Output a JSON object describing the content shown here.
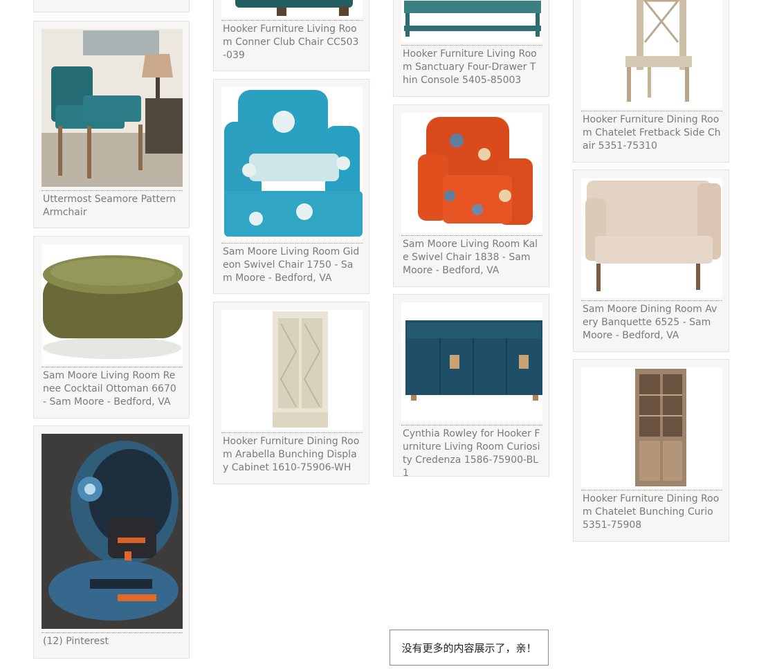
{
  "pins": [
    {
      "id": "uttermost-seamore",
      "caption": "Uttermost Seamore Pattern Armchair",
      "image_subject": "teal-armchair-image"
    },
    {
      "id": "sam-moore-renee-ottoman",
      "caption": "Sam Moore Living Room Renee Cocktail Ottoman 6670 - Sam Moore - Bedford, VA",
      "image_subject": "olive-round-ottoman-image"
    },
    {
      "id": "pinterest-robot",
      "caption": "(12) Pinterest",
      "image_subject": "robot-bust-image"
    },
    {
      "id": "hooker-conner-club-chair",
      "caption": "Hooker Furniture Living Room Conner Club Chair CC503-039",
      "image_subject": "club-chair-image"
    },
    {
      "id": "sam-moore-gideon-swivel",
      "caption": "Sam Moore Living Room Gideon Swivel Chair 1750 - Sam Moore - Bedford, VA",
      "image_subject": "blue-ikat-swivel-chair-image"
    },
    {
      "id": "hooker-arabella-cabinet",
      "caption": "Hooker Furniture Dining Room Arabella Bunching Display Cabinet 1610-75906-WH",
      "image_subject": "white-display-cabinet-image"
    },
    {
      "id": "hooker-sanctuary-console",
      "caption": "Hooker Furniture Living Room Sanctuary Four-Drawer Thin Console 5405-85003",
      "image_subject": "teal-console-image"
    },
    {
      "id": "sam-moore-kale-swivel",
      "caption": "Sam Moore Living Room Kale Swivel Chair 1838 - Sam Moore - Bedford, VA",
      "image_subject": "orange-floral-chair-image"
    },
    {
      "id": "cynthia-rowley-credenza",
      "caption": "Cynthia Rowley for Hooker Furniture Living Room Curiosity Credenza 1586-75900-BL1",
      "image_subject": "navy-credenza-image"
    },
    {
      "id": "hooker-chatelet-side-chair",
      "caption": "Hooker Furniture Dining Room Chatelet Fretback Side Chair 5351-75310",
      "image_subject": "fretback-side-chair-image"
    },
    {
      "id": "sam-moore-avery-banquette",
      "caption": "Sam Moore Dining Room Avery Banquette 6525 - Sam Moore - Bedford, VA",
      "image_subject": "beige-banquette-image"
    },
    {
      "id": "hooker-chatelet-curio",
      "caption": "Hooker Furniture Dining Room Chatelet Bunching Curio 5351-75908",
      "image_subject": "wood-curio-cabinet-image"
    }
  ],
  "footer": {
    "no_more_text": "没有更多的内容展示了，亲！"
  },
  "colors": {
    "card_bg": "#f7f6f4",
    "card_border": "#e3e1dd",
    "caption_text": "#7d7a75"
  }
}
